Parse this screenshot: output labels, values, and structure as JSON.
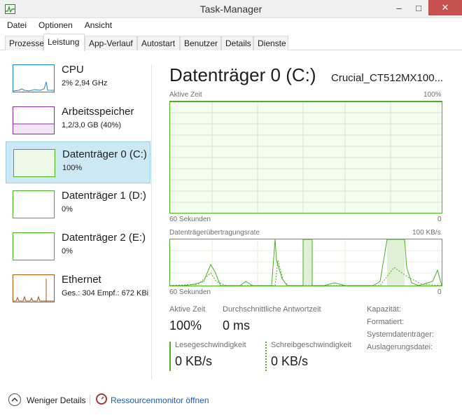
{
  "window": {
    "title": "Task-Manager"
  },
  "menu": [
    "Datei",
    "Optionen",
    "Ansicht"
  ],
  "tabs": [
    "Prozesse",
    "Leistung",
    "App-Verlauf",
    "Autostart",
    "Benutzer",
    "Details",
    "Dienste"
  ],
  "active_tab": "Leistung",
  "sidebar": {
    "items": [
      {
        "name": "CPU",
        "value": "2%  2,94 GHz",
        "color": "#1c86c4"
      },
      {
        "name": "Arbeitsspeicher",
        "value": "1,2/3,0 GB (40%)",
        "color": "#8b2ea0"
      },
      {
        "name": "Datenträger 0 (C:)",
        "value": "100%",
        "color": "#4caf24"
      },
      {
        "name": "Datenträger 1 (D:)",
        "value": "0%",
        "color": "#4caf24"
      },
      {
        "name": "Datenträger 2 (E:)",
        "value": "0%",
        "color": "#4caf24"
      },
      {
        "name": "Ethernet",
        "value": "Ges.: 304  Empf.: 672 KBi",
        "color": "#a85b12"
      }
    ],
    "selected_index": 2
  },
  "main": {
    "title": "Datenträger 0 (C:)",
    "model": "Crucial_CT512MX100...",
    "graph1": {
      "label": "Aktive Zeit",
      "max": "100%",
      "time": "60 Sekunden",
      "min": "0",
      "level": 1.0
    },
    "graph2": {
      "label": "Datenträgerübertragungsrate",
      "max": "100 KB/s",
      "time": "60 Sekunden",
      "min": "0"
    },
    "stats": {
      "active_time_label": "Aktive Zeit",
      "active_time_value": "100%",
      "response_label": "Durchschnittliche Antwortzeit",
      "response_value": "0 ms",
      "read_label": "Lesegeschwindigkeit",
      "read_value": "0 KB/s",
      "write_label": "Schreibgeschwindigkeit",
      "write_value": "0 KB/s",
      "capacity_label": "Kapazität:",
      "formatted_label": "Formatiert:",
      "system_disk_label": "Systemdatenträger:",
      "pagefile_label": "Auslagerungsdatei:"
    }
  },
  "footer": {
    "less_details": "Weniger Details",
    "resource_monitor": "Ressourcenmonitor öffnen"
  },
  "colors": {
    "accent_green": "#4caf24",
    "link_blue": "#1a5ea8",
    "selection": "#cce8f5"
  }
}
